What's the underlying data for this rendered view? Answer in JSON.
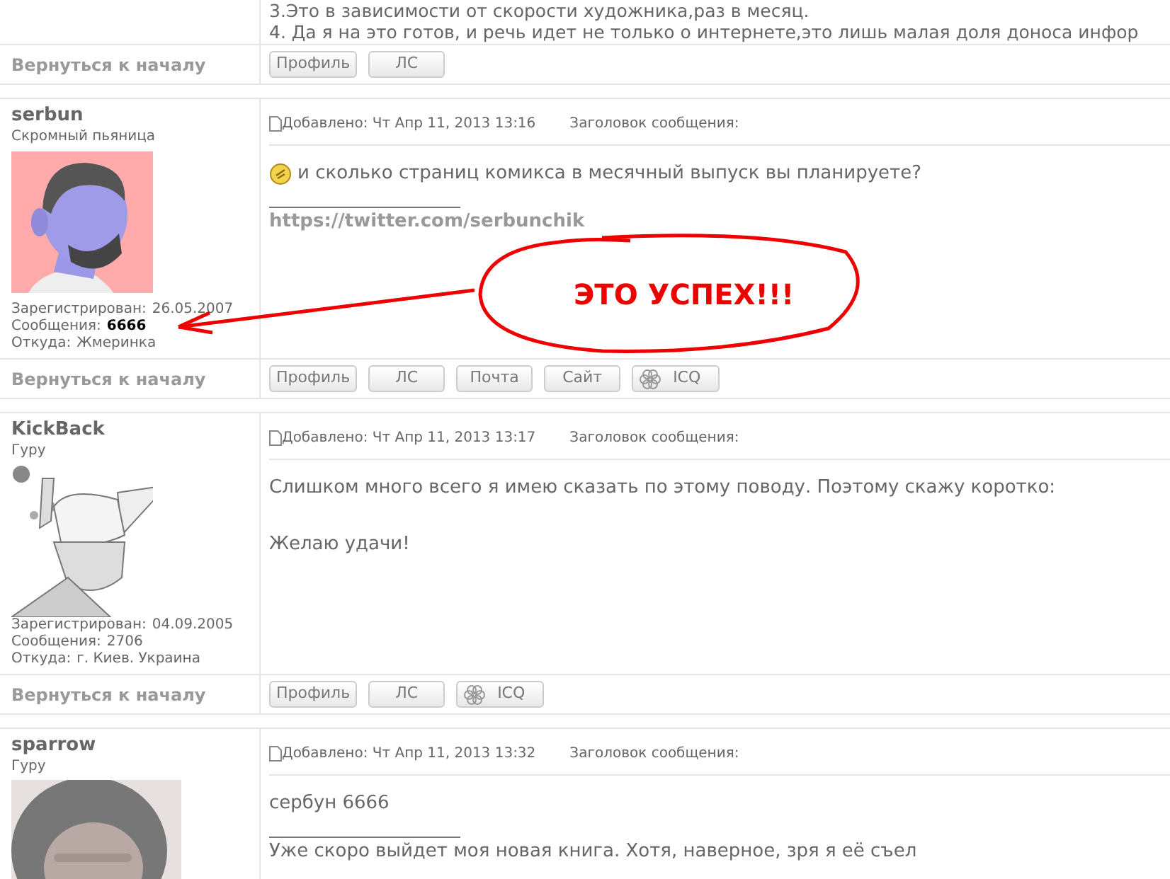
{
  "top_post": {
    "body": [
      {
        "kind": "text",
        "text": "3.Это в зависимости от скорости художника,раз в месяц."
      },
      {
        "kind": "text",
        "text": "4. Да я на это готов, и речь идет не только о интернете,это лишь малая доля доноса инфор"
      }
    ],
    "footer_link": "Вернуться к началу",
    "buttons": [
      {
        "label": "Профиль",
        "kind": "plain"
      },
      {
        "label": "ЛС",
        "kind": "plain"
      }
    ]
  },
  "posts": [
    {
      "author": "serbun",
      "rank": "Скромный пьяница",
      "stats": [
        {
          "label": "Зарегистрирован:",
          "value": "26.05.2007",
          "highlight": false
        },
        {
          "label": "Сообщения:",
          "value": "6666",
          "highlight": true
        },
        {
          "label": "Откуда:",
          "value": "Жмеринка",
          "highlight": false
        }
      ],
      "added": "Добавлено: Чт Апр 11, 2013 13:16",
      "subject_label": "Заголовок сообщения:",
      "body": [
        {
          "kind": "smiley_text",
          "text": "и сколько страниц комикса в месячный выпуск вы планируете?"
        },
        {
          "kind": "rule"
        },
        {
          "kind": "link",
          "text": "https://twitter.com/serbunchik"
        }
      ],
      "footer_link": "Вернуться к началу",
      "buttons": [
        {
          "label": "Профиль",
          "kind": "plain"
        },
        {
          "label": "ЛС",
          "kind": "plain"
        },
        {
          "label": "Почта",
          "kind": "plain"
        },
        {
          "label": "Сайт",
          "kind": "plain"
        },
        {
          "label": "ICQ",
          "kind": "icq"
        }
      ]
    },
    {
      "author": "KickBack",
      "rank": "Гуру",
      "stats": [
        {
          "label": "Зарегистрирован:",
          "value": "04.09.2005",
          "highlight": false
        },
        {
          "label": "Сообщения:",
          "value": "2706",
          "highlight": false
        },
        {
          "label": "Откуда:",
          "value": "г. Киев. Украина",
          "highlight": false
        }
      ],
      "added": "Добавлено: Чт Апр 11, 2013 13:17",
      "subject_label": "Заголовок сообщения:",
      "body": [
        {
          "kind": "text",
          "text": "Слишком много всего я имею сказать по этому поводу. Поэтому скажу коротко:"
        },
        {
          "kind": "gap"
        },
        {
          "kind": "text",
          "text": "Желаю удачи!"
        }
      ],
      "footer_link": "Вернуться к началу",
      "buttons": [
        {
          "label": "Профиль",
          "kind": "plain"
        },
        {
          "label": "ЛС",
          "kind": "plain"
        },
        {
          "label": "ICQ",
          "kind": "icq"
        }
      ]
    },
    {
      "author": "sparrow",
      "rank": "Гуру",
      "added": "Добавлено: Чт Апр 11, 2013 13:32",
      "subject_label": "Заголовок сообщения:",
      "body": [
        {
          "kind": "text",
          "text": "сербун 6666"
        },
        {
          "kind": "rule"
        },
        {
          "kind": "text",
          "text": "Уже скоро выйдет моя новая книга. Хотя, наверное, зря я её съел"
        }
      ]
    }
  ],
  "annotation": {
    "text": "ЭТО УСПЕХ!!!"
  }
}
